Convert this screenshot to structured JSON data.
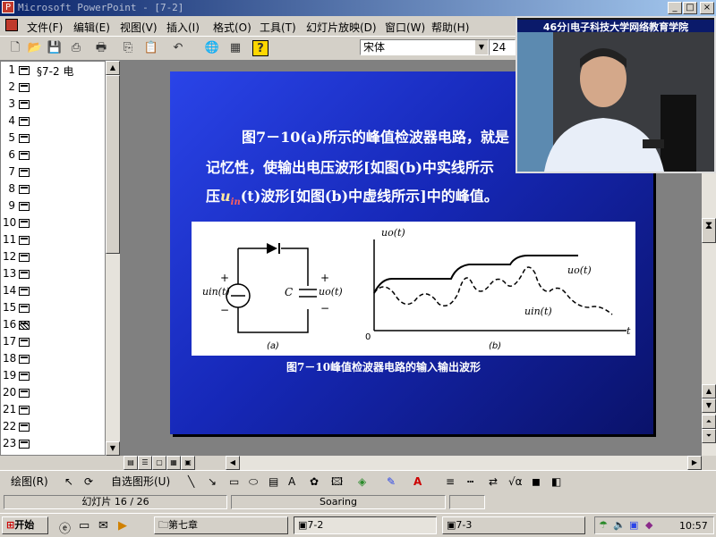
{
  "window": {
    "app_icon": "P",
    "title": "Microsoft PowerPoint - [7-2]",
    "controls": [
      "_",
      "□",
      "×"
    ]
  },
  "menu": [
    "文件(F)",
    "编辑(E)",
    "视图(V)",
    "插入(I)",
    "格式(O)",
    "工具(T)",
    "幻灯片放映(D)",
    "窗口(W)",
    "帮助(H)"
  ],
  "toolbar": {
    "font_name": "宋体",
    "font_size": "24"
  },
  "outline": {
    "rows": [
      {
        "num": "1",
        "title": "§7-2  电"
      },
      {
        "num": "2",
        "title": ""
      },
      {
        "num": "3",
        "title": ""
      },
      {
        "num": "4",
        "title": ""
      },
      {
        "num": "5",
        "title": ""
      },
      {
        "num": "6",
        "title": ""
      },
      {
        "num": "7",
        "title": ""
      },
      {
        "num": "8",
        "title": ""
      },
      {
        "num": "9",
        "title": ""
      },
      {
        "num": "10",
        "title": ""
      },
      {
        "num": "11",
        "title": ""
      },
      {
        "num": "12",
        "title": ""
      },
      {
        "num": "13",
        "title": ""
      },
      {
        "num": "14",
        "title": ""
      },
      {
        "num": "15",
        "title": ""
      },
      {
        "num": "16",
        "title": ""
      },
      {
        "num": "17",
        "title": ""
      },
      {
        "num": "18",
        "title": ""
      },
      {
        "num": "19",
        "title": ""
      },
      {
        "num": "20",
        "title": ""
      },
      {
        "num": "21",
        "title": ""
      },
      {
        "num": "22",
        "title": ""
      },
      {
        "num": "23",
        "title": ""
      }
    ],
    "selected_num": "16"
  },
  "slide": {
    "line1": "图7－10(a)所示的峰值检波器电路，就是",
    "line2": "记忆性，使输出电压波形[如图(b)中实线所示",
    "line3_pre": "压",
    "line3_var": "u",
    "line3_sub": "in",
    "line3_post": "(t)波形[如图(b)中虚线所示]中的峰值。",
    "figure": {
      "uin_label": "uin(t)",
      "uo_label": "uo(t)",
      "c_label": "C",
      "plus": "+",
      "minus": "−",
      "part_a": "(a)",
      "part_b": "(b)",
      "axis_y": "uo(t)",
      "axis_x": "t",
      "origin": "0",
      "curve_uo": "uo(t)",
      "curve_uin": "uin(t)"
    },
    "caption": "图7－10峰值检波器电路的输入输出波形"
  },
  "drawbar": {
    "draw_label": "绘图(R)",
    "autoshape_label": "自选图形(U)"
  },
  "status": {
    "slide_pos": "幻灯片 16 / 26",
    "template": "Soaring"
  },
  "taskbar": {
    "start": "开始",
    "items": [
      "第七章",
      "7-2",
      "7-3"
    ],
    "time": "10:57"
  },
  "video": {
    "label": "46分|电子科技大学网络教育学院"
  },
  "colors": {
    "slide_bg": "#1e30c8",
    "title_bar": "#0a246a"
  }
}
